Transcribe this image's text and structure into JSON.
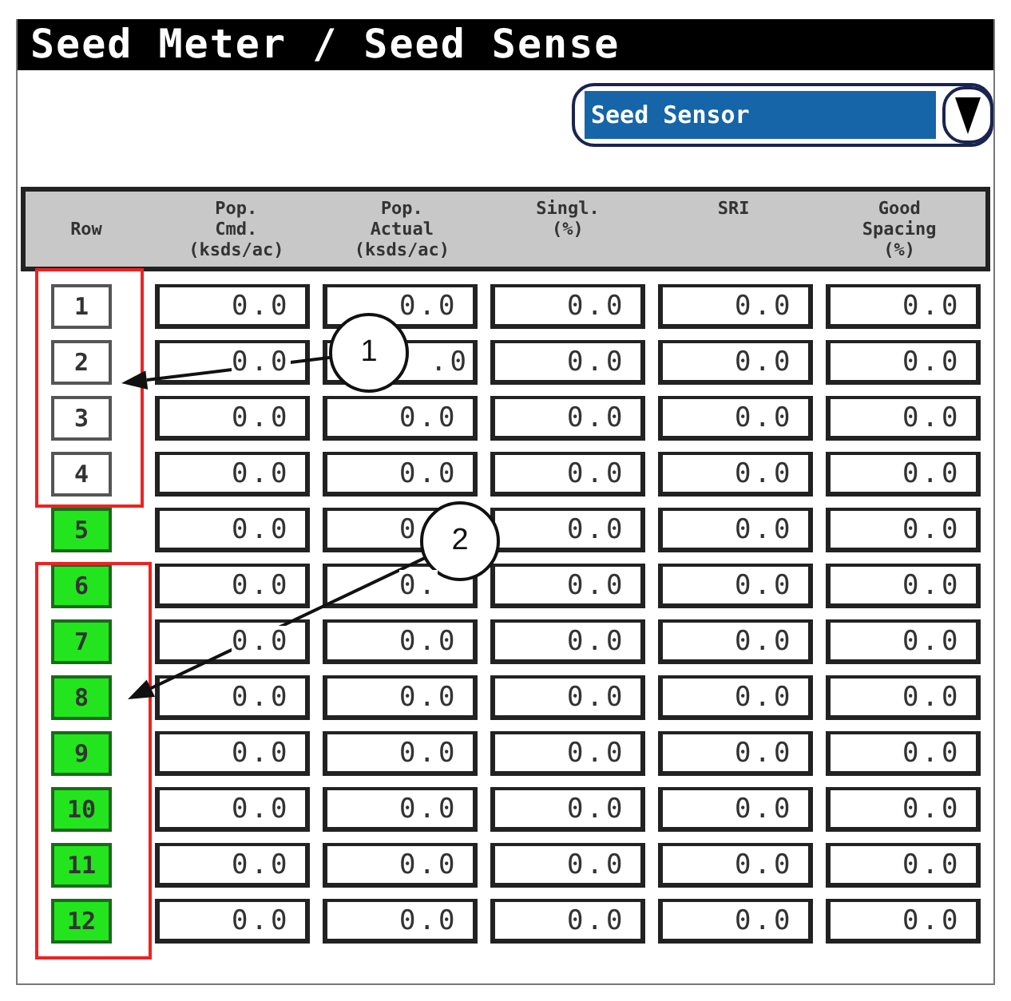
{
  "window": {
    "title": "Seed Meter / Seed Sense"
  },
  "dropdown": {
    "value": "Seed Sensor"
  },
  "table": {
    "columns": [
      "Row",
      "Pop.\nCmd.\n(ksds/ac)",
      "Pop.\nActual\n(ksds/ac)",
      "Singl.\n(%)",
      "SRI",
      "Good\nSpacing\n(%)"
    ],
    "rows": [
      {
        "row": "1",
        "active": false,
        "values": [
          "0.0",
          "0.0",
          "0.0",
          "0.0",
          "0.0"
        ]
      },
      {
        "row": "2",
        "active": false,
        "values": [
          "0.0",
          ".0",
          "0.0",
          "0.0",
          "0.0"
        ]
      },
      {
        "row": "3",
        "active": false,
        "values": [
          "0.0",
          "0.0",
          "0.0",
          "0.0",
          "0.0"
        ]
      },
      {
        "row": "4",
        "active": false,
        "values": [
          "0.0",
          "0.0",
          "0.0",
          "0.0",
          "0.0"
        ]
      },
      {
        "row": "5",
        "active": true,
        "values": [
          "0.0",
          "0",
          "0.0",
          "0.0",
          "0.0"
        ]
      },
      {
        "row": "6",
        "active": true,
        "values": [
          "0.0",
          "0.",
          "0.0",
          "0.0",
          "0.0"
        ]
      },
      {
        "row": "7",
        "active": true,
        "values": [
          "0.0",
          "0.0",
          "0.0",
          "0.0",
          "0.0"
        ]
      },
      {
        "row": "8",
        "active": true,
        "values": [
          "0.0",
          "0.0",
          "0.0",
          "0.0",
          "0.0"
        ]
      },
      {
        "row": "9",
        "active": true,
        "values": [
          "0.0",
          "0.0",
          "0.0",
          "0.0",
          "0.0"
        ]
      },
      {
        "row": "10",
        "active": true,
        "values": [
          "0.0",
          "0.0",
          "0.0",
          "0.0",
          "0.0"
        ]
      },
      {
        "row": "11",
        "active": true,
        "values": [
          "0.0",
          "0.0",
          "0.0",
          "0.0",
          "0.0"
        ]
      },
      {
        "row": "12",
        "active": true,
        "values": [
          "0.0",
          "0.0",
          "0.0",
          "0.0",
          "0.0"
        ]
      }
    ]
  },
  "callouts": [
    {
      "label": "1"
    },
    {
      "label": "2"
    }
  ]
}
